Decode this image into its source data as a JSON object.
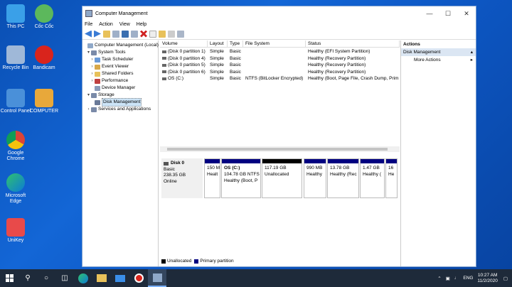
{
  "desktop": {
    "icons": [
      {
        "label": "This PC"
      },
      {
        "label": "Cốc Cốc"
      },
      {
        "label": "Recycle Bin"
      },
      {
        "label": "Bandicam"
      },
      {
        "label": "Control Panel"
      },
      {
        "label": "COMPUTER"
      },
      {
        "label": "Google Chrome"
      },
      {
        "label": "Microsoft Edge"
      },
      {
        "label": "UniKey"
      }
    ]
  },
  "window": {
    "title": "Computer Management",
    "menu": [
      "File",
      "Action",
      "View",
      "Help"
    ]
  },
  "tree": {
    "root": "Computer Management (Local)",
    "system_tools": "System Tools",
    "task_scheduler": "Task Scheduler",
    "event_viewer": "Event Viewer",
    "shared_folders": "Shared Folders",
    "performance": "Performance",
    "device_manager": "Device Manager",
    "storage": "Storage",
    "disk_management": "Disk Management",
    "services": "Services and Applications"
  },
  "volumes": {
    "headers": [
      "Volume",
      "Layout",
      "Type",
      "File System",
      "Status"
    ],
    "rows": [
      {
        "volume": "(Disk 0 partition 1)",
        "layout": "Simple",
        "type": "Basic",
        "fs": "",
        "status": "Healthy (EFI System Partition)"
      },
      {
        "volume": "(Disk 0 partition 4)",
        "layout": "Simple",
        "type": "Basic",
        "fs": "",
        "status": "Healthy (Recovery Partition)"
      },
      {
        "volume": "(Disk 0 partition 5)",
        "layout": "Simple",
        "type": "Basic",
        "fs": "",
        "status": "Healthy (Recovery Partition)"
      },
      {
        "volume": "(Disk 0 partition 6)",
        "layout": "Simple",
        "type": "Basic",
        "fs": "",
        "status": "Healthy (Recovery Partition)"
      },
      {
        "volume": "OS (C:)",
        "layout": "Simple",
        "type": "Basic",
        "fs": "NTFS (BitLocker Encrypted)",
        "status": "Healthy (Boot, Page File, Crash Dump, Prim"
      }
    ]
  },
  "disk": {
    "name": "Disk 0",
    "type": "Basic",
    "size": "238.35 GB",
    "state": "Online",
    "partitions": [
      {
        "title": "",
        "line1": "150 M",
        "line2": "Healt"
      },
      {
        "title": "OS  (C:)",
        "line1": "104.78 GB NTFS",
        "line2": "Healthy (Boot, P"
      },
      {
        "title": "",
        "line1": "117.19 GB",
        "line2": "Unallocated"
      },
      {
        "title": "",
        "line1": "990 MB",
        "line2": "Healthy"
      },
      {
        "title": "",
        "line1": "13.78 GB",
        "line2": "Healthy (Rec"
      },
      {
        "title": "",
        "line1": "1.47 GB",
        "line2": "Healthy ("
      },
      {
        "title": "",
        "line1": "16",
        "line2": "He"
      }
    ]
  },
  "legend": {
    "unallocated": "Unallocated",
    "primary": "Primary partition"
  },
  "actions": {
    "header": "Actions",
    "section": "Disk Management",
    "more": "More Actions"
  },
  "taskbar": {
    "lang": "ENG",
    "time": "10:27 AM",
    "date": "11/2/2020"
  },
  "colors": {
    "primary_partition": "#000080",
    "unallocated": "#000000",
    "taskbar": "#1e2a3a"
  }
}
